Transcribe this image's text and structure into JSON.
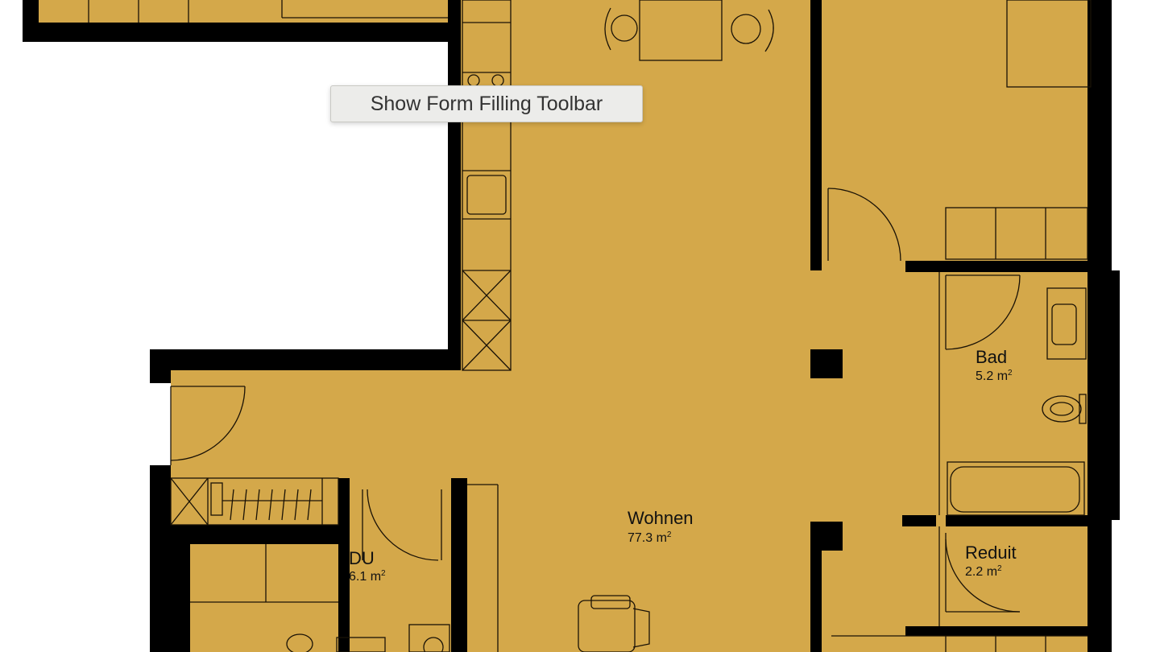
{
  "colors": {
    "floor": "#d4a84a",
    "wall": "#000000",
    "line": "#1a1206",
    "background": "#ffffff",
    "tooltip_bg": "#ececea"
  },
  "tooltip": {
    "text": "Show Form Filling Toolbar"
  },
  "rooms": [
    {
      "name": "Wohnen",
      "area": "77.3",
      "unit": "m",
      "unit_exp": "2"
    },
    {
      "name": "Bad",
      "area": "5.2",
      "unit": "m",
      "unit_exp": "2"
    },
    {
      "name": "DU",
      "area": "6.1",
      "unit": "m",
      "unit_exp": "2"
    },
    {
      "name": "Reduit",
      "area": "2.2",
      "unit": "m",
      "unit_exp": "2"
    }
  ]
}
